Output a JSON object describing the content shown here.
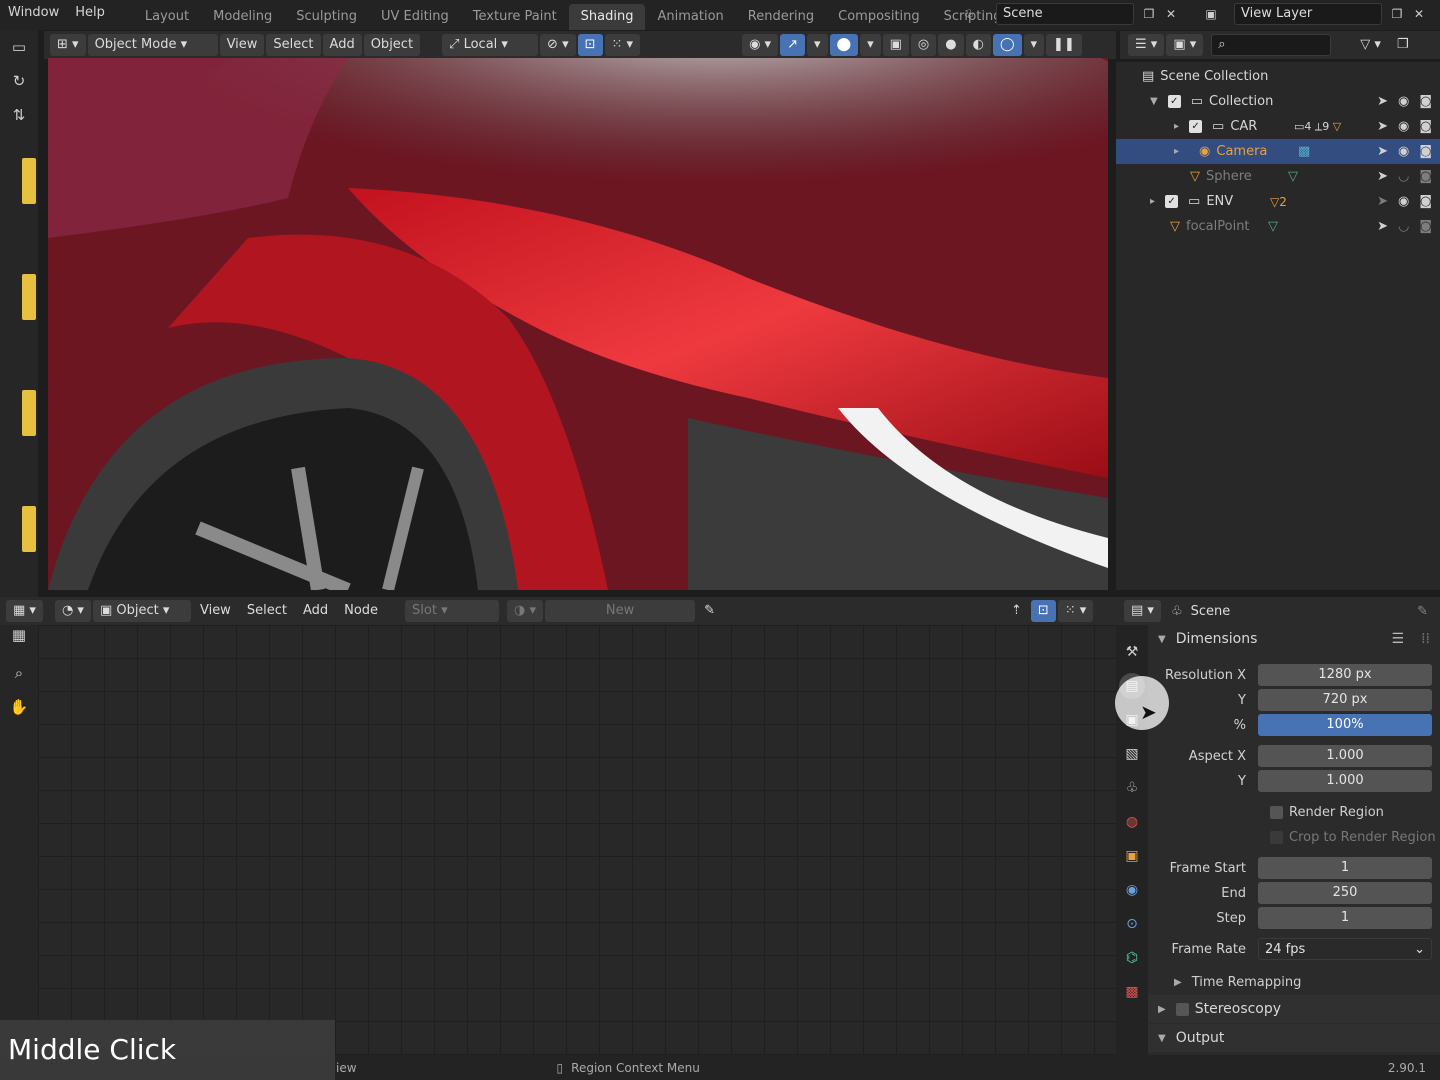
{
  "topbar": {
    "menus": [
      "Window",
      "Help"
    ],
    "workspaces": [
      "Layout",
      "Modeling",
      "Sculpting",
      "UV Editing",
      "Texture Paint",
      "Shading",
      "Animation",
      "Rendering",
      "Compositing",
      "Scripting"
    ],
    "active_workspace": "Shading",
    "scene_name": "Scene",
    "view_layer": "View Layer"
  },
  "viewport_header": {
    "mode": "Object Mode",
    "menus": [
      "View",
      "Select",
      "Add",
      "Object"
    ],
    "transform_orientation": "Local"
  },
  "outliner": {
    "root": "Scene Collection",
    "items": [
      {
        "label": "Collection",
        "depth": 1,
        "checked": true,
        "type": "collection"
      },
      {
        "label": "CAR",
        "depth": 2,
        "checked": true,
        "type": "collection",
        "badge1": "4",
        "badge2": "9"
      },
      {
        "label": "Camera",
        "depth": 2,
        "checked": false,
        "type": "camera",
        "selected": true
      },
      {
        "label": "Sphere",
        "depth": 2,
        "checked": false,
        "type": "mesh",
        "dim": true
      },
      {
        "label": "ENV",
        "depth": 1,
        "checked": true,
        "type": "collection",
        "badge1": "2"
      },
      {
        "label": "focalPoint",
        "depth": 1,
        "checked": false,
        "type": "empty",
        "dim": true
      }
    ]
  },
  "node_editor_header": {
    "object_label": "Object",
    "menus": [
      "View",
      "Select",
      "Add",
      "Node"
    ],
    "slot_label": "Slot",
    "new_label": "New"
  },
  "properties": {
    "context": "Scene",
    "dimensions_label": "Dimensions",
    "resolution_x_label": "Resolution X",
    "resolution_x": "1280 px",
    "resolution_y_label": "Y",
    "resolution_y": "720 px",
    "percent_label": "%",
    "percent": "100%",
    "aspect_x_label": "Aspect X",
    "aspect_x": "1.000",
    "aspect_y_label": "Y",
    "aspect_y": "1.000",
    "render_region_label": "Render Region",
    "crop_label": "Crop to Render Region",
    "frame_start_label": "Frame Start",
    "frame_start": "1",
    "end_label": "End",
    "frame_end": "250",
    "step_label": "Step",
    "frame_step": "1",
    "frame_rate_label": "Frame Rate",
    "frame_rate": "24 fps",
    "time_remapping_label": "Time Remapping",
    "stereoscopy_label": "Stereoscopy",
    "output_label": "Output"
  },
  "statusbar": {
    "left_hint": "iew",
    "middle_hint": "Region Context Menu",
    "version": "2.90.1"
  },
  "keycast": "Middle Click",
  "colors": {
    "accent": "#4772b3",
    "selected_row": "#334d80",
    "tool_yellow": "#e8c040"
  }
}
